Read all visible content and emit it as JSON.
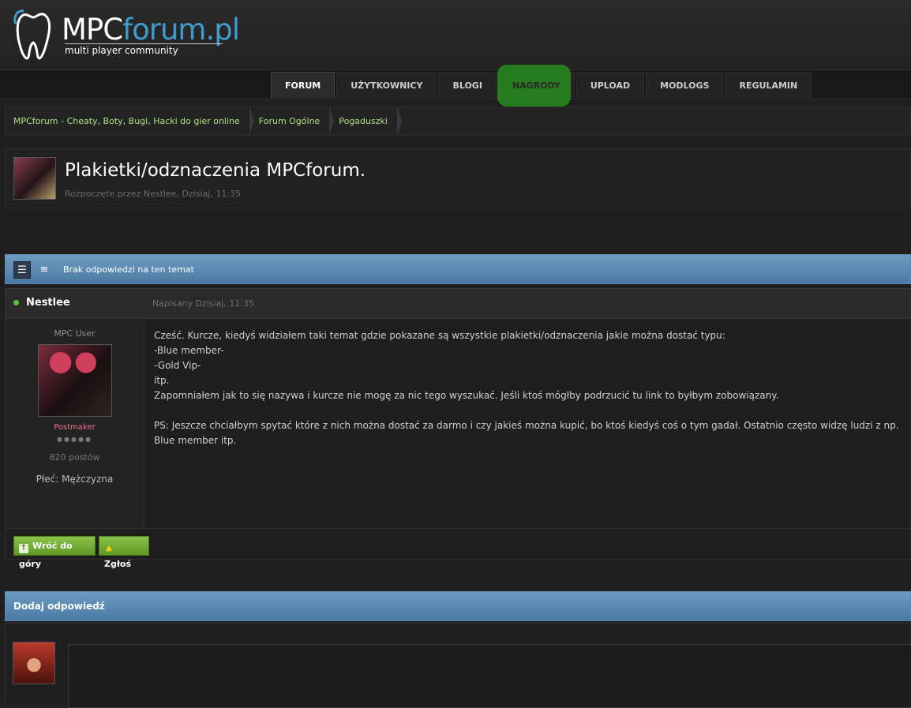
{
  "site": {
    "logo_main": "MPC",
    "logo_accent": "forum.pl",
    "tagline": "multi player community"
  },
  "nav": {
    "tabs": [
      {
        "label": "FORUM",
        "active": true
      },
      {
        "label": "UŻYTKOWNICY"
      },
      {
        "label": "BLOGI"
      },
      {
        "label": "NAGRODY"
      },
      {
        "label": "UPLOAD"
      },
      {
        "label": "MODLOGS"
      },
      {
        "label": "REGULAMIN"
      }
    ]
  },
  "breadcrumb": [
    "MPCforum - Cheaty, Boty, Bugi, Hacki do gier online",
    "Forum Ogólne",
    "Pogaduszki"
  ],
  "topic": {
    "title": "Plakietki/odznaczenia MPCforum.",
    "meta": "Rozpoczęte przez Nestlee, Dzisiaj, 11:35"
  },
  "toolbar": {
    "no_replies": "Brak odpowiedzi na ten temat"
  },
  "post": {
    "author": "Nestlee",
    "date": "Napisany Dzisiaj, 11:35",
    "user_group": "MPC User",
    "rank": "Postmaker",
    "post_count": "820 postów",
    "gender": "Płeć: Mężczyzna",
    "body": "   Cześć. Kurcze, kiedyś widziałem taki temat gdzie pokazane są wszystkie plakietki/odznaczenia jakie można dostać typu:\n   -Blue member-\n-Gold Vip-\nitp.\nZapomniałem jak to się nazywa i kurcze nie mogę za nic tego wyszukać. Jeśli ktoś mógłby podrzucić tu link to byłbym zobowiązany.\n\nPS: Jeszcze chciałbym spytać które z nich można dostać za darmo i czy jakieś można kupić, bo ktoś kiedyś coś o tym gadał. Ostatnio często widzę ludzi z np. Blue member itp.",
    "back_to_top": "Wróć do góry",
    "report": "Zgłoś"
  },
  "reply": {
    "title": "Dodaj odpowiedź"
  },
  "colors": {
    "accent_blue": "#3f9ccd",
    "link_green": "#aee083",
    "button_green": "#7ab536",
    "highlight_green": "#288c1e"
  }
}
